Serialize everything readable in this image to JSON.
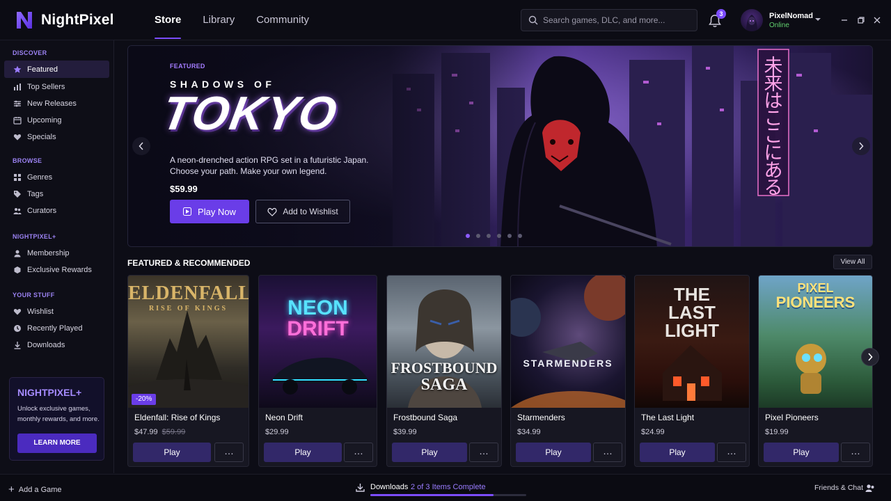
{
  "app": {
    "name": "NightPixel"
  },
  "nav": {
    "tabs": [
      {
        "label": "Store"
      },
      {
        "label": "Library"
      },
      {
        "label": "Community"
      }
    ]
  },
  "search": {
    "placeholder": "Search games, DLC, and more..."
  },
  "notifications": {
    "count": "3"
  },
  "user": {
    "name": "PixelNomad",
    "status": "Online"
  },
  "sidebar": {
    "sections": [
      {
        "heading": "DISCOVER",
        "items": [
          {
            "label": "Featured",
            "icon": "star-icon"
          },
          {
            "label": "Top Sellers",
            "icon": "bar-chart-icon"
          },
          {
            "label": "New Releases",
            "icon": "sliders-icon"
          },
          {
            "label": "Upcoming",
            "icon": "calendar-icon"
          },
          {
            "label": "Specials",
            "icon": "tag-heart-icon"
          }
        ]
      },
      {
        "heading": "BROWSE",
        "items": [
          {
            "label": "Genres",
            "icon": "grid-icon"
          },
          {
            "label": "Tags",
            "icon": "tag-icon"
          },
          {
            "label": "Curators",
            "icon": "people-icon"
          }
        ]
      },
      {
        "heading": "NIGHTPIXEL+",
        "items": [
          {
            "label": "Membership",
            "icon": "person-icon"
          },
          {
            "label": "Exclusive Rewards",
            "icon": "gift-icon"
          }
        ]
      },
      {
        "heading": "YOUR STUFF",
        "items": [
          {
            "label": "Wishlist",
            "icon": "heart-icon"
          },
          {
            "label": "Recently Played",
            "icon": "clock-icon"
          },
          {
            "label": "Downloads",
            "icon": "download-icon"
          }
        ]
      }
    ],
    "promo": {
      "title": "NIGHTPIXEL+",
      "desc": "Unlock exclusive games, monthly rewards, and more.",
      "button": "LEARN MORE"
    }
  },
  "hero": {
    "badge": "FEATURED",
    "subtitle": "SHADOWS OF",
    "title": "TOKYO",
    "desc": "A neon-drenched action RPG set in a futuristic Japan. Choose your path. Make your own legend.",
    "price": "$59.99",
    "play_label": "Play Now",
    "wishlist_label": "Add to Wishlist",
    "sign_text": "未来はここにある",
    "slides": 6,
    "active_slide": 0
  },
  "section": {
    "title": "FEATURED & RECOMMENDED",
    "view_all": "View All"
  },
  "games": [
    {
      "name": "Eldenfall: Rise of Kings",
      "price": "$47.99",
      "old_price": "$59.99",
      "discount": "-20%",
      "art_title": "ELDENFALL",
      "art_sub": "RISE OF KINGS",
      "play": "Play"
    },
    {
      "name": "Neon Drift",
      "price": "$29.99",
      "art_title": "NEON",
      "art_sub": "DRIFT",
      "play": "Play"
    },
    {
      "name": "Frostbound Saga",
      "price": "$39.99",
      "art_title": "FROSTBOUND",
      "art_sub": "SAGA",
      "play": "Play"
    },
    {
      "name": "Starmenders",
      "price": "$34.99",
      "art_title": "STARMENDERS",
      "play": "Play"
    },
    {
      "name": "The Last Light",
      "price": "$24.99",
      "art_title": "THE",
      "art_sub": "LAST",
      "art_sub2": "LIGHT",
      "play": "Play"
    },
    {
      "name": "Pixel Pioneers",
      "price": "$19.99",
      "art_title": "PIXEL",
      "art_sub": "PIONEERS",
      "play": "Play"
    }
  ],
  "bottom": {
    "add_game": "Add a Game",
    "downloads_label": "Downloads",
    "downloads_status": "2 of 3 Items Complete",
    "downloads_progress": 0.79,
    "friends": "Friends & Chat"
  },
  "colors": {
    "accent": "#7c4dff",
    "accent_dark": "#322869",
    "bg": "#0d0d16",
    "online": "#62d26f"
  }
}
